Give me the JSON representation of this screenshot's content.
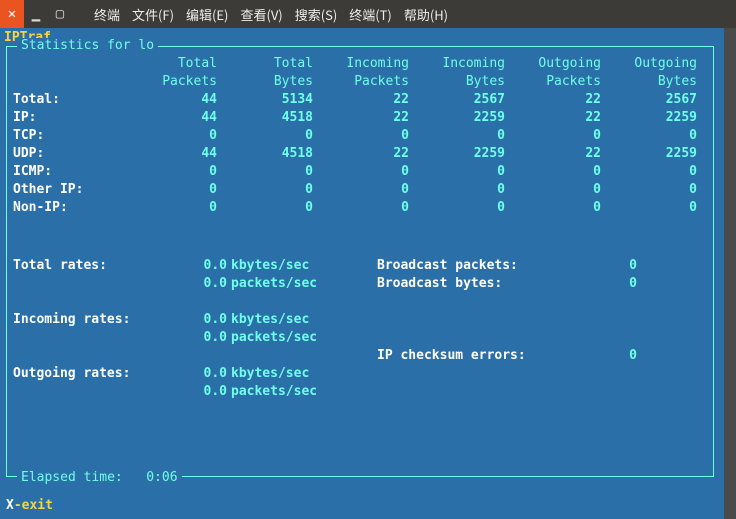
{
  "window": {
    "menu": [
      "终端",
      "文件(F)",
      "编辑(E)",
      "查看(V)",
      "搜索(S)",
      "终端(T)",
      "帮助(H)"
    ]
  },
  "app_title": "IPTraf",
  "frame_label": "Statistics for lo",
  "headers": {
    "h1a": "Total",
    "h1b": "Packets",
    "h2a": "Total",
    "h2b": "Bytes",
    "h3a": "Incoming",
    "h3b": "Packets",
    "h4a": "Incoming",
    "h4b": "Bytes",
    "h5a": "Outgoing",
    "h5b": "Packets",
    "h6a": "Outgoing",
    "h6b": "Bytes"
  },
  "rows": {
    "total": {
      "label": "Total:",
      "c1": "44",
      "c2": "5134",
      "c3": "22",
      "c4": "2567",
      "c5": "22",
      "c6": "2567"
    },
    "ip": {
      "label": "IP:",
      "c1": "44",
      "c2": "4518",
      "c3": "22",
      "c4": "2259",
      "c5": "22",
      "c6": "2259"
    },
    "tcp": {
      "label": "TCP:",
      "c1": "0",
      "c2": "0",
      "c3": "0",
      "c4": "0",
      "c5": "0",
      "c6": "0"
    },
    "udp": {
      "label": "UDP:",
      "c1": "44",
      "c2": "4518",
      "c3": "22",
      "c4": "2259",
      "c5": "22",
      "c6": "2259"
    },
    "icmp": {
      "label": "ICMP:",
      "c1": "0",
      "c2": "0",
      "c3": "0",
      "c4": "0",
      "c5": "0",
      "c6": "0"
    },
    "other": {
      "label": "Other IP:",
      "c1": "0",
      "c2": "0",
      "c3": "0",
      "c4": "0",
      "c5": "0",
      "c6": "0"
    },
    "nonip": {
      "label": "Non-IP:",
      "c1": "0",
      "c2": "0",
      "c3": "0",
      "c4": "0",
      "c5": "0",
      "c6": "0"
    }
  },
  "rates": {
    "total_label": "Total rates:",
    "incoming_label": "Incoming rates:",
    "outgoing_label": "Outgoing rates:",
    "total_kb": "0.0",
    "total_kb_unit": "kbytes/sec",
    "total_pk": "0.0",
    "total_pk_unit": "packets/sec",
    "in_kb": "0.0",
    "in_kb_unit": "kbytes/sec",
    "in_pk": "0.0",
    "in_pk_unit": "packets/sec",
    "out_kb": "0.0",
    "out_kb_unit": "kbytes/sec",
    "out_pk": "0.0",
    "out_pk_unit": "packets/sec"
  },
  "misc": {
    "bcast_pkts_label": "Broadcast packets:",
    "bcast_pkts": "0",
    "bcast_bytes_label": "Broadcast bytes:",
    "bcast_bytes": "0",
    "ipcksum_label": "IP checksum errors:",
    "ipcksum": "0"
  },
  "elapsed_label": "Elapsed time:",
  "elapsed_value": "0:06",
  "hint_key": "X",
  "hint_text": "-exit"
}
